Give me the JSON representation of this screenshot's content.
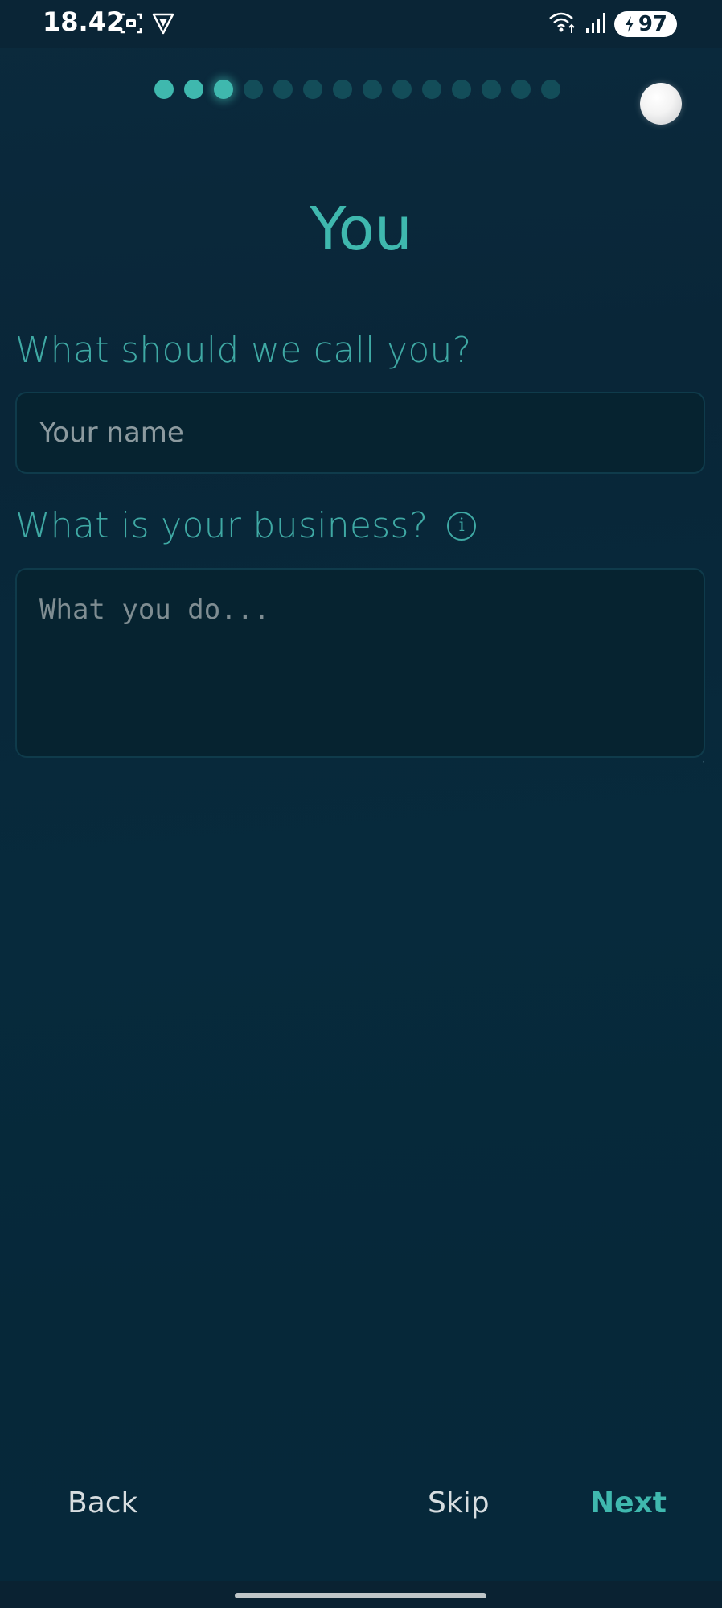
{
  "status_bar": {
    "time": "18.42",
    "battery_level": "97",
    "left_icons": [
      "screenshot-icon",
      "vpn-shield-icon"
    ],
    "right_icons": [
      "wifi-icon",
      "signal-icon",
      "battery-charging-icon"
    ]
  },
  "progress": {
    "total_steps": 14,
    "current_step": 3
  },
  "page": {
    "title": "You"
  },
  "form": {
    "name_label": "What should we call you?",
    "name_placeholder": "Your name",
    "name_value": "",
    "business_label": "What is your business?",
    "business_placeholder": "What you do...",
    "business_value": "",
    "info_icon": "info-icon"
  },
  "nav": {
    "back_label": "Back",
    "skip_label": "Skip",
    "next_label": "Next"
  },
  "colors": {
    "accent": "#3fb8ae",
    "background": "#072a3c",
    "inactive_dot": "#134d59",
    "input_background": "#062330"
  }
}
